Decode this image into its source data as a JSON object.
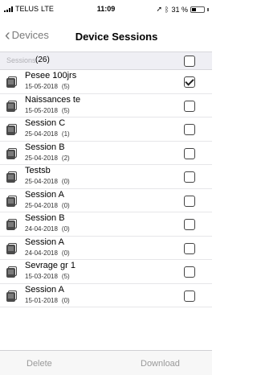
{
  "status": {
    "carrier": "TELUS",
    "network": "LTE",
    "time": "11:09",
    "battery": "31 %"
  },
  "nav": {
    "back_label": "Devices",
    "title": "Device Sessions"
  },
  "header": {
    "label": "Sessions",
    "count": "(26)"
  },
  "rows": [
    {
      "name": "Pesee 100jrs",
      "date": "15-05-2018",
      "count": "(5)",
      "checked": true
    },
    {
      "name": "Naissances te",
      "date": "15-05-2018",
      "count": "(5)",
      "checked": false
    },
    {
      "name": "Session C",
      "date": "25-04-2018",
      "count": "(1)",
      "checked": false
    },
    {
      "name": "Session B",
      "date": "25-04-2018",
      "count": "(2)",
      "checked": false
    },
    {
      "name": "Testsb",
      "date": "25-04-2018",
      "count": "(0)",
      "checked": false
    },
    {
      "name": "Session A",
      "date": "25-04-2018",
      "count": "(0)",
      "checked": false
    },
    {
      "name": "Session B",
      "date": "24-04-2018",
      "count": "(0)",
      "checked": false
    },
    {
      "name": "Session A",
      "date": "24-04-2018",
      "count": "(0)",
      "checked": false
    },
    {
      "name": "Sevrage gr 1",
      "date": "15-03-2018",
      "count": "(5)",
      "checked": false
    },
    {
      "name": "Session A",
      "date": "15-01-2018",
      "count": "(0)",
      "checked": false
    }
  ],
  "toolbar": {
    "delete_label": "Delete",
    "download_label": "Download"
  }
}
